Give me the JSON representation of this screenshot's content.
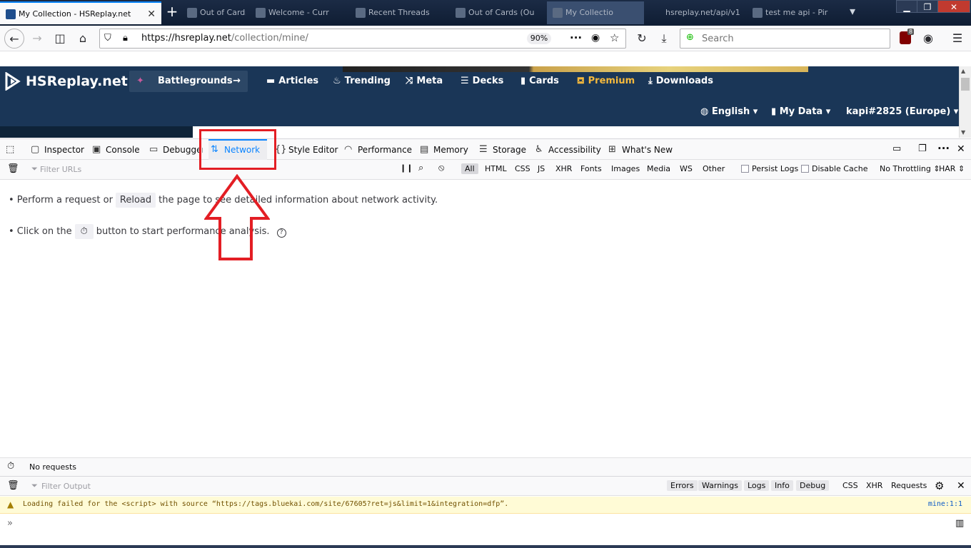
{
  "browser": {
    "tabs": [
      {
        "title": "My Collection - HSReplay.net",
        "active": true
      },
      {
        "title": "Out of Cards (Ou",
        "active": false
      },
      {
        "title": "Welcome - Curr",
        "active": false
      },
      {
        "title": "Recent Threads",
        "active": false
      },
      {
        "title": "Out of Cards (Ou",
        "active": false
      },
      {
        "title": "My Collectio",
        "active": false
      },
      {
        "title": "hsreplay.net/api/v1",
        "active": false
      },
      {
        "title": "test me api - Pir",
        "active": false
      }
    ],
    "url_host": "https://hsreplay.net",
    "url_path": "/collection/mine/",
    "zoom": "90%",
    "search_placeholder": "Search",
    "ublock_count": "8"
  },
  "site": {
    "logo": "HSReplay.net",
    "battlegrounds": "Battlegrounds",
    "nav": [
      "Articles",
      "Trending",
      "Meta",
      "Decks",
      "Cards",
      "Premium",
      "Downloads"
    ],
    "language": "English",
    "my_data": "My Data",
    "account": "kapi#2825 (Europe)",
    "colors": {
      "header": "#1a3657",
      "premium": "#f5b93d"
    }
  },
  "devtools": {
    "tabs": [
      "Inspector",
      "Console",
      "Debugger",
      "Network",
      "Style Editor",
      "Performance",
      "Memory",
      "Storage",
      "Accessibility",
      "What's New"
    ],
    "selected_tab": "Network",
    "filter_placeholder": "Filter URLs",
    "type_filters": [
      "All",
      "HTML",
      "CSS",
      "JS",
      "XHR",
      "Fonts",
      "Images",
      "Media",
      "WS",
      "Other"
    ],
    "persist_logs": "Persist Logs",
    "disable_cache": "Disable Cache",
    "throttling": "No Throttling",
    "har": "HAR",
    "empty": {
      "line1_pre": "• Perform a request or",
      "line1_btn": "Reload",
      "line1_post": "the page to see detailed information about network activity.",
      "line2_pre": "• Click on the",
      "line2_post": "button to start performance analysis."
    },
    "status": "No requests",
    "console": {
      "filter_placeholder": "Filter Output",
      "levels": [
        "Errors",
        "Warnings",
        "Logs",
        "Info",
        "Debug"
      ],
      "types": [
        "CSS",
        "XHR",
        "Requests"
      ],
      "warning_text": "Loading failed for the <script> with source “https://tags.bluekai.com/site/67605?ret=js&limit=1&integration=dfp”.",
      "warning_location": "mine:1:1"
    }
  },
  "annotation": {
    "color": "#e31e24"
  }
}
